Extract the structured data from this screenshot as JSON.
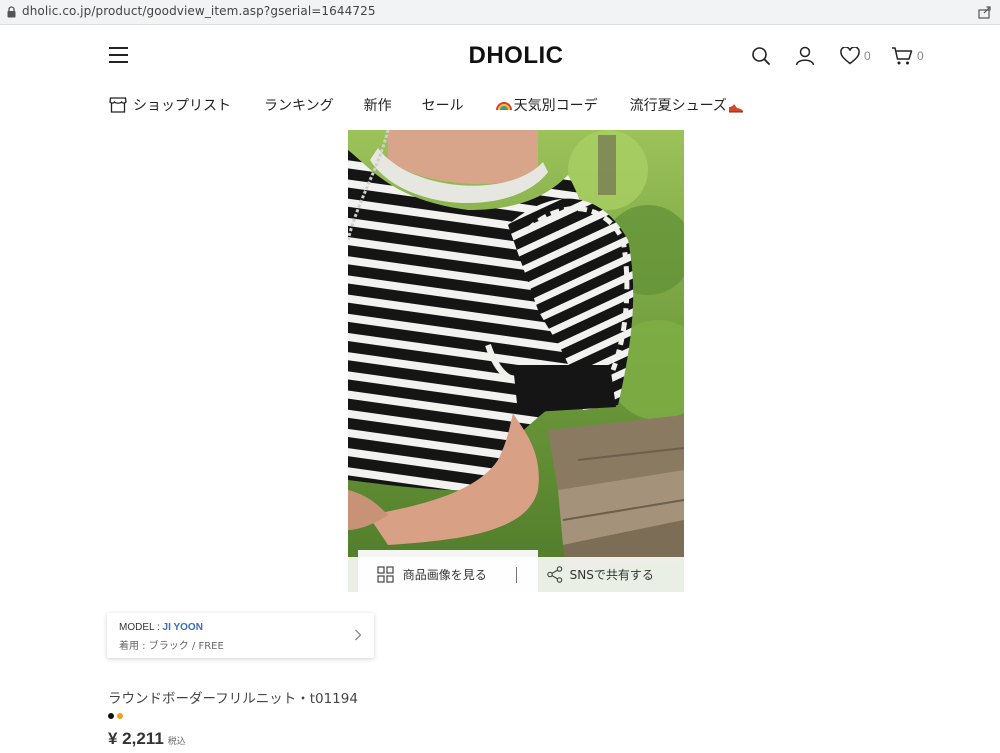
{
  "browser": {
    "url": "dholic.co.jp/product/goodview_item.asp?gserial=1644725"
  },
  "header": {
    "logo": "DHOLIC",
    "wishlist_count": "0",
    "cart_count": "0"
  },
  "nav": {
    "items": [
      {
        "label": "ショップリスト",
        "icon": "shop-icon"
      },
      {
        "label": "ランキング"
      },
      {
        "label": "新作"
      },
      {
        "label": "セール"
      },
      {
        "label": "天気別コーデ",
        "icon": "rainbow-icon"
      },
      {
        "label": "流行夏シューズ",
        "icon": "shoe-icon"
      }
    ]
  },
  "product_image": {
    "view_images_label": "商品画像を見る",
    "share_label": "SNSで共有する"
  },
  "model": {
    "prefix": "MODEL : ",
    "name": "JI YOON",
    "wearing": "着用 : ブラック / FREE"
  },
  "product": {
    "name": "ラウンドボーダーフリルニット・t01194",
    "colors": [
      "#111111",
      "#f0a020"
    ],
    "price": "¥ 2,211",
    "tax_label": "税込"
  }
}
